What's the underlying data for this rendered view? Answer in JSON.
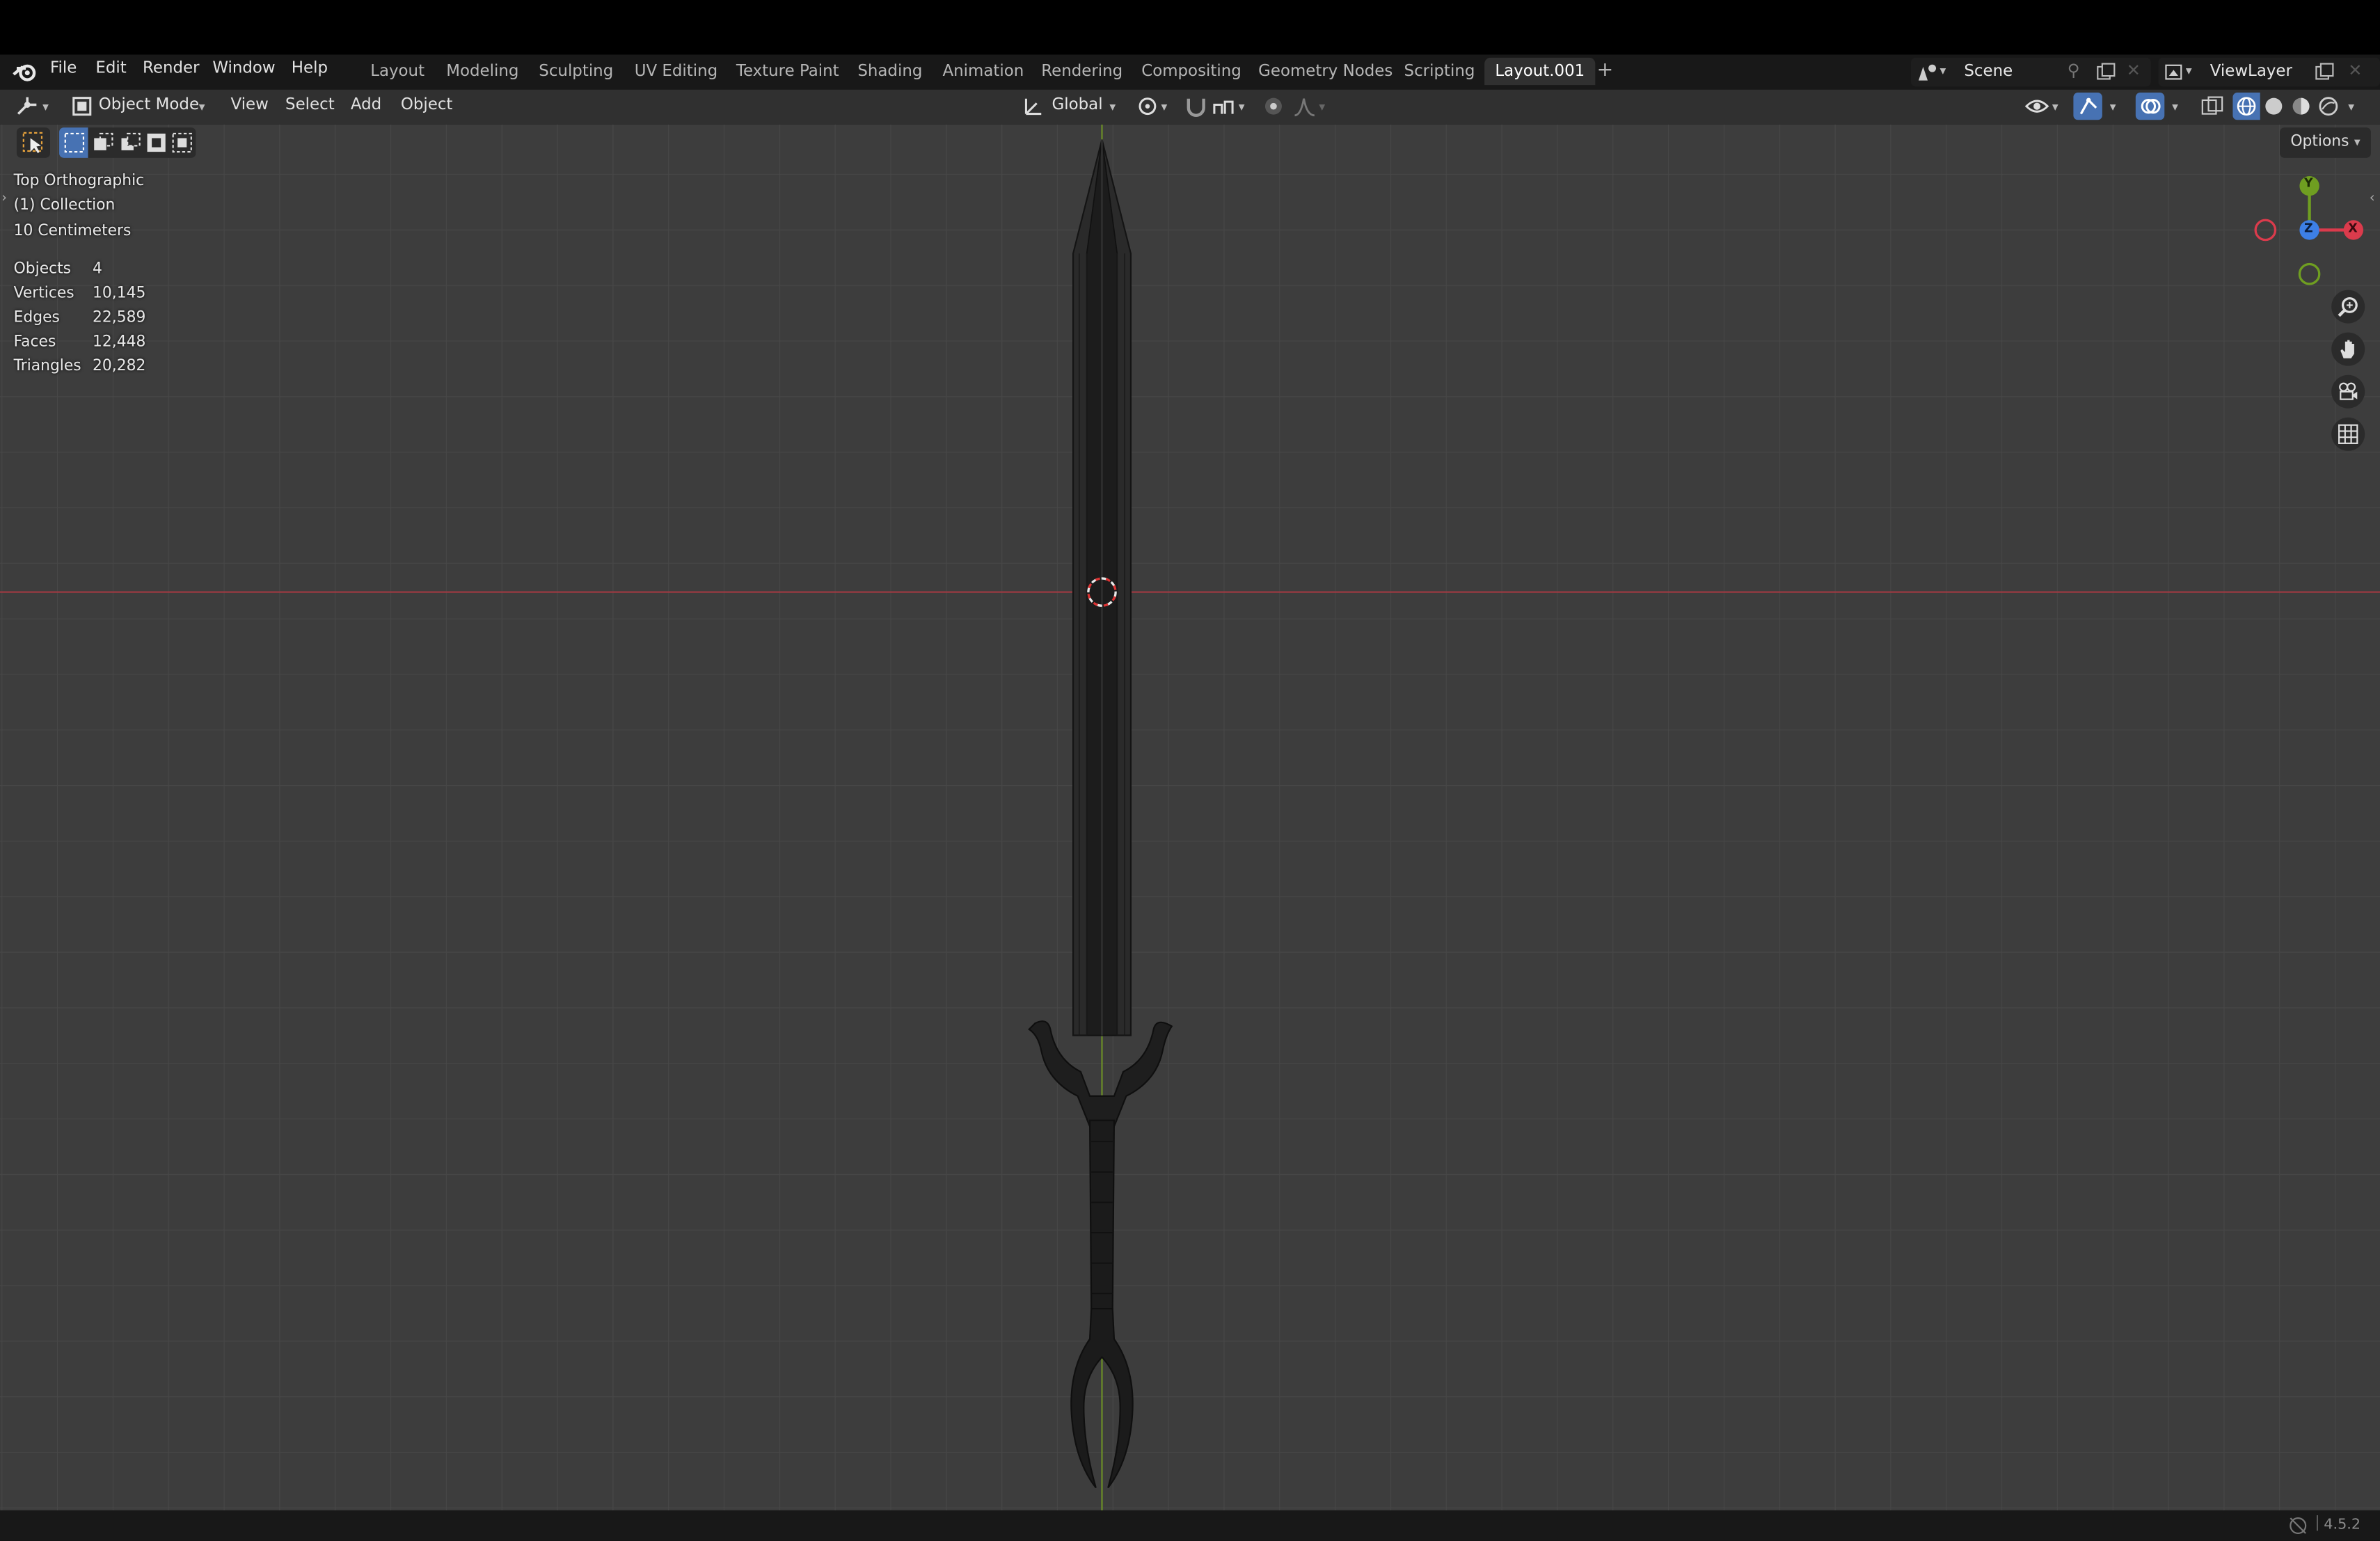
{
  "topbar": {
    "menus": [
      "File",
      "Edit",
      "Render",
      "Window",
      "Help"
    ],
    "workspaces": [
      "Layout",
      "Modeling",
      "Sculpting",
      "UV Editing",
      "Texture Paint",
      "Shading",
      "Animation",
      "Rendering",
      "Compositing",
      "Geometry Nodes",
      "Scripting",
      "Layout.001"
    ],
    "active_workspace": "Layout.001",
    "add_tab": "+",
    "scene": "Scene",
    "view_layer": "ViewLayer"
  },
  "header": {
    "mode": "Object Mode",
    "menus": [
      "View",
      "Select",
      "Add",
      "Object"
    ],
    "orientation": "Global",
    "options": "Options"
  },
  "overlay": {
    "view_name": "Top Orthographic",
    "collection": "(1) Collection",
    "scale": "10 Centimeters",
    "stats": [
      {
        "label": "Objects",
        "value": "4"
      },
      {
        "label": "Vertices",
        "value": "10,145"
      },
      {
        "label": "Edges",
        "value": "22,589"
      },
      {
        "label": "Faces",
        "value": "12,448"
      },
      {
        "label": "Triangles",
        "value": "20,282"
      }
    ]
  },
  "gizmo": {
    "y": "Y",
    "z": "Z",
    "x": "X"
  },
  "status": {
    "version": "4.5.2"
  },
  "colors": {
    "accent": "#4772b3",
    "x_axis": "#db3b4c",
    "y_axis": "#6f9e21",
    "z_axis": "#3d7fe6",
    "viewport_bg": "#3d3d3d"
  }
}
